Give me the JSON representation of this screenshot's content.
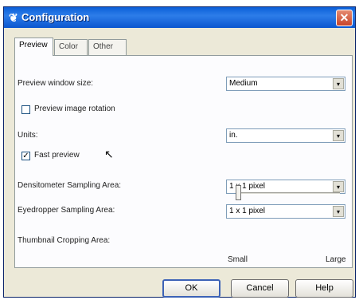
{
  "window": {
    "title": "Configuration"
  },
  "tabs": [
    {
      "label": "Preview"
    },
    {
      "label": "Color"
    },
    {
      "label": "Other"
    }
  ],
  "preview": {
    "window_size_label": "Preview window size:",
    "window_size_value": "Medium",
    "image_rotation_label": "Preview image rotation",
    "image_rotation_checked": false,
    "units_label": "Units:",
    "units_value": "in.",
    "fast_preview_label": "Fast preview",
    "fast_preview_checked": true,
    "densitometer_label": "Densitometer Sampling Area:",
    "densitometer_value": "1 x 1 pixel",
    "eyedropper_label": "Eyedropper Sampling Area:",
    "eyedropper_value": "1 x 1 pixel",
    "thumbnail_label": "Thumbnail Cropping Area:",
    "slider_min_label": "Small",
    "slider_max_label": "Large",
    "slider_value_fraction": 0.0
  },
  "buttons": {
    "ok": "OK",
    "cancel": "Cancel",
    "help": "Help"
  },
  "icons": {
    "arrow": "▾",
    "check": "✓",
    "close": "✕"
  }
}
